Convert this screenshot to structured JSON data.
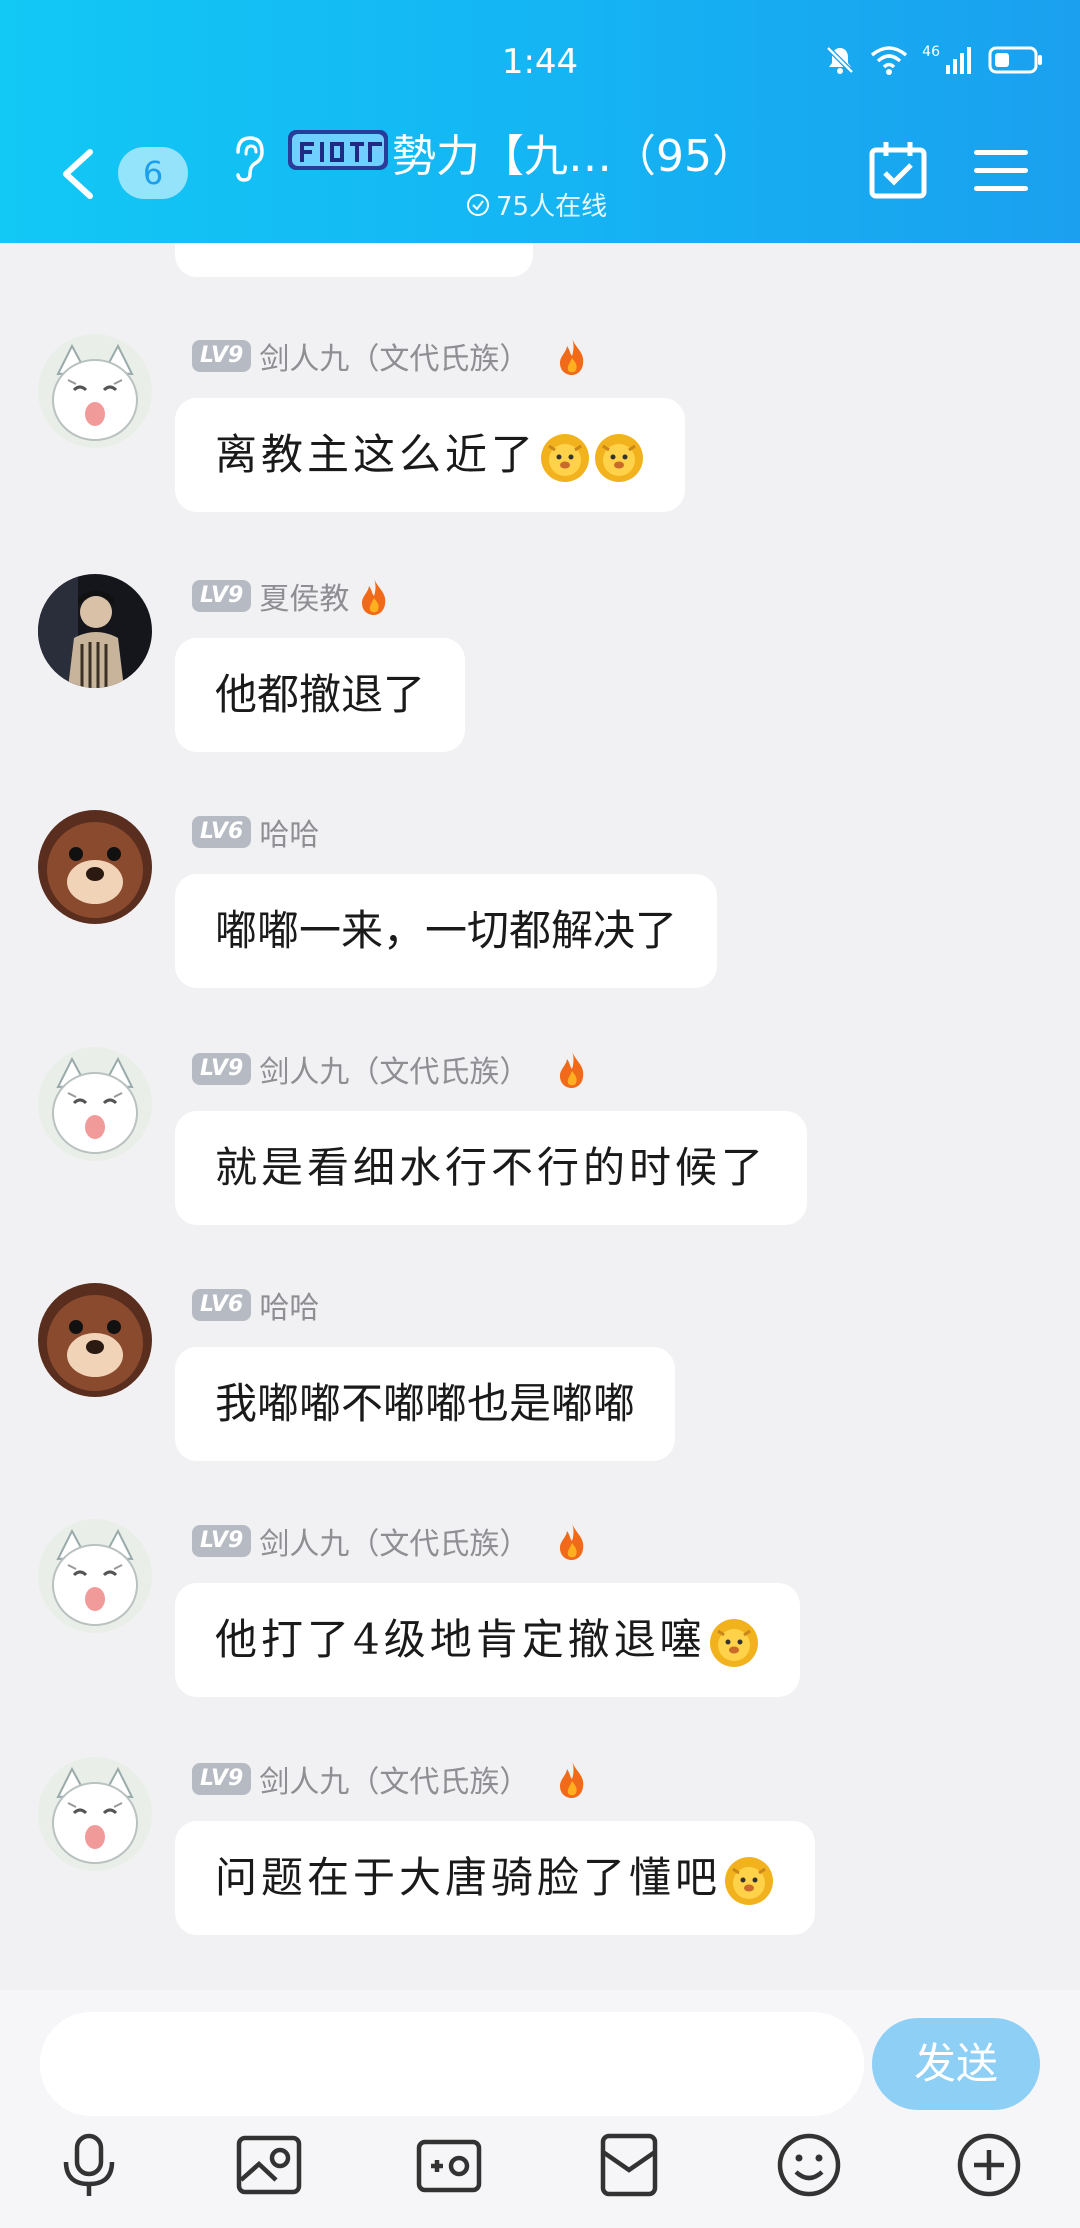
{
  "status_bar": {
    "time": "1:44",
    "network": "46"
  },
  "header": {
    "unread_count": "6",
    "group_title": "勢力【九…（95）",
    "online_text": "75人在线"
  },
  "messages": [
    {
      "level": "LV9",
      "name": "剑人九（文代氏族）",
      "text": "离教主这么近了",
      "emojis": 2,
      "hand": true
    },
    {
      "level": "LV9",
      "name": "夏侯教",
      "text": "他都撤退了",
      "emojis": 0,
      "hand": false
    },
    {
      "level": "LV6",
      "name": "哈哈",
      "text": "嘟嘟一来，一切都解决了",
      "emojis": 0,
      "hand": false
    },
    {
      "level": "LV9",
      "name": "剑人九（文代氏族）",
      "text": "就是看细水行不行的时候了",
      "emojis": 0,
      "hand": true
    },
    {
      "level": "LV6",
      "name": "哈哈",
      "text": "我嘟嘟不嘟嘟也是嘟嘟",
      "emojis": 0,
      "hand": false
    },
    {
      "level": "LV9",
      "name": "剑人九（文代氏族）",
      "text": "他打了4级地肯定撤退噻",
      "emojis": 1,
      "hand": true
    },
    {
      "level": "LV9",
      "name": "剑人九（文代氏族）",
      "text": "问题在于大唐骑脸了懂吧",
      "emojis": 1,
      "hand": true
    }
  ],
  "input": {
    "placeholder": "",
    "send_label": "发送"
  },
  "colors": {
    "header_start": "#12c8f5",
    "header_end": "#1aa0ef",
    "send_button": "#8ecff5"
  },
  "icons": [
    "microphone-icon",
    "image-icon",
    "camera-icon",
    "file-icon",
    "emoji-icon",
    "plus-icon"
  ]
}
